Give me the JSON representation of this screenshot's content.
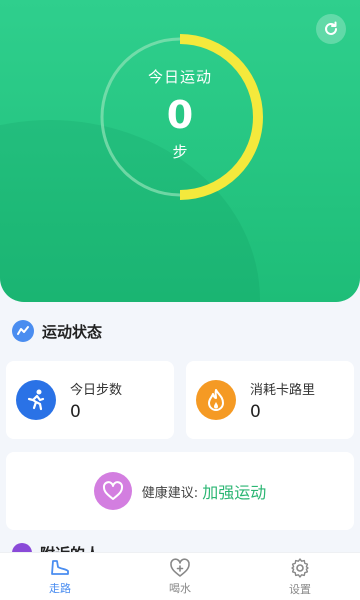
{
  "header": {
    "ring_title": "今日运动",
    "steps_value": "0",
    "steps_unit": "步",
    "progress_fraction": 0.5,
    "colors": {
      "bg": "#2fcf8d",
      "ring_track": "#8ee3b7",
      "ring_progress": "#f4e93c"
    },
    "refresh_icon": "refresh-icon"
  },
  "status_section": {
    "title": "运动状态",
    "icon": "chart-icon"
  },
  "cards": {
    "steps": {
      "label": "今日步数",
      "value": "0",
      "icon": "running-person-icon",
      "color": "#2a72e6"
    },
    "calories": {
      "label": "消耗卡路里",
      "value": "0",
      "icon": "flame-icon",
      "color": "#f59a24"
    }
  },
  "advice": {
    "label": "健康建议:",
    "value": "加强运动",
    "icon": "heart-icon",
    "color": "#d37ee0"
  },
  "next_section": {
    "title": "附近的人"
  },
  "tabs": [
    {
      "label": "走路",
      "icon": "shoe-icon",
      "active": true
    },
    {
      "label": "喝水",
      "icon": "heart-drop-icon",
      "active": false
    },
    {
      "label": "设置",
      "icon": "gear-icon",
      "active": false
    }
  ]
}
